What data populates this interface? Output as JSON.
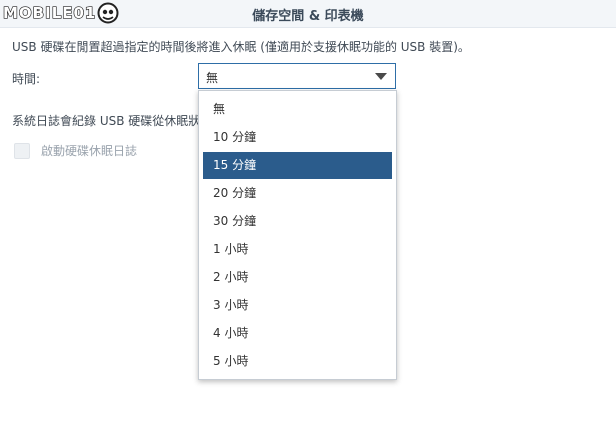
{
  "watermark": {
    "text": "MOBILE01"
  },
  "header": {
    "title": "儲存空間 & 印表機"
  },
  "settings": {
    "description": "USB 硬碟在閒置超過指定的時間後將進入休眠 (僅適用於支援休眠功能的 USB 裝置)。",
    "time_label": "時間:",
    "selected_value": "無",
    "log_text": "系統日誌會紀錄 USB 硬碟從休眠狀",
    "log_checkbox_label": "啟動硬碟休眠日誌",
    "log_checkbox_checked": false,
    "log_checkbox_disabled": true
  },
  "dropdown": {
    "options": [
      {
        "label": "無"
      },
      {
        "label": "10 分鐘"
      },
      {
        "label": "15 分鐘"
      },
      {
        "label": "20 分鐘"
      },
      {
        "label": "30 分鐘"
      },
      {
        "label": "1 小時"
      },
      {
        "label": "2 小時"
      },
      {
        "label": "3 小時"
      },
      {
        "label": "4 小時"
      },
      {
        "label": "5 小時"
      }
    ],
    "highlighted_index": 2
  },
  "colors": {
    "highlight": "#2b5c8c",
    "select_border": "#2e6ea7",
    "header_bg": "#f3f6f9"
  }
}
